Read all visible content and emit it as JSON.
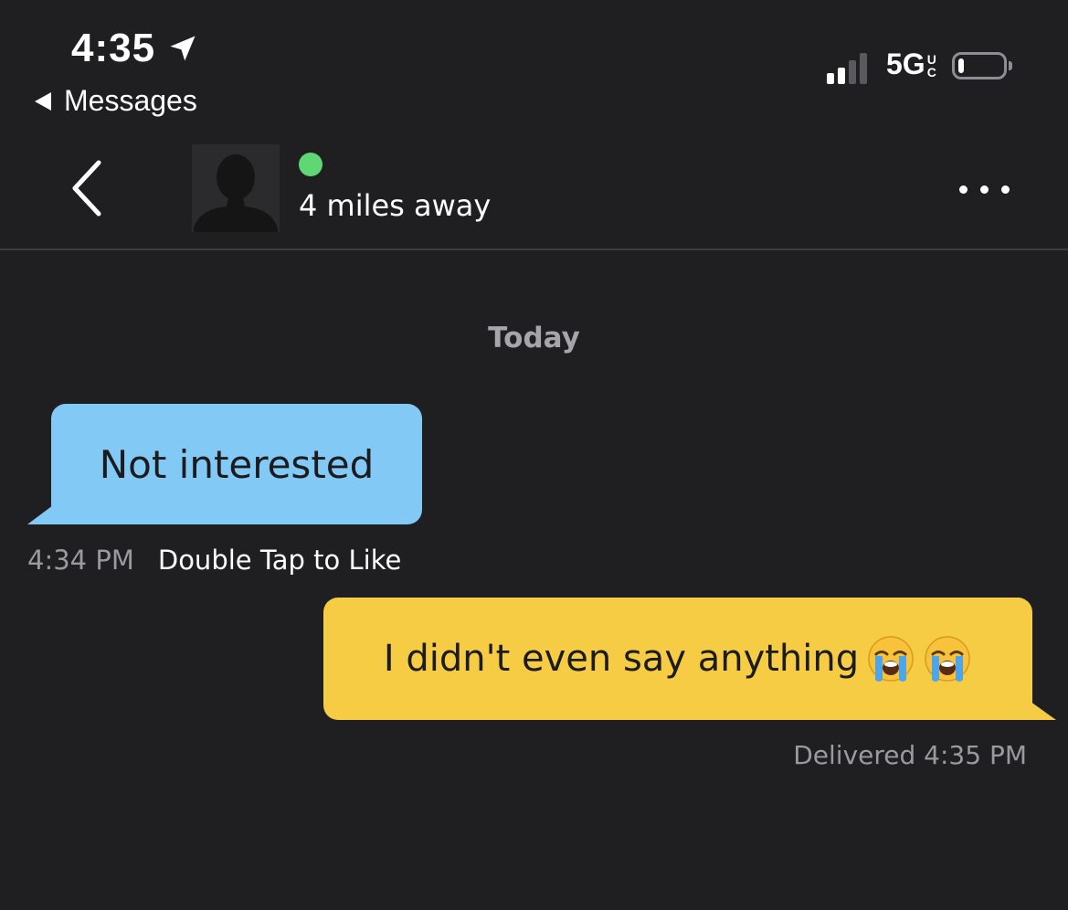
{
  "status_bar": {
    "time": "4:35",
    "back_app_label": "Messages",
    "network": "5G",
    "network_suffix_top": "U",
    "network_suffix_bottom": "C",
    "signal_bars_active": 2,
    "signal_bars_total": 4,
    "battery_level": 0.15
  },
  "header": {
    "distance": "4 miles away",
    "online": true
  },
  "chat": {
    "date_divider": "Today",
    "messages": [
      {
        "direction": "incoming",
        "text": "Not interested",
        "time": "4:34 PM",
        "action": "Double Tap to Like"
      },
      {
        "direction": "outgoing",
        "text": "I didn't even say anything",
        "emoji": "loudly-crying-face",
        "emoji_count": 2,
        "status": "Delivered 4:35 PM"
      }
    ]
  },
  "colors": {
    "background": "#1f1f21",
    "incoming_bubble": "#82c9f6",
    "outgoing_bubble": "#f6cc44",
    "online": "#5fd775",
    "muted_text": "#9a9a9e"
  }
}
